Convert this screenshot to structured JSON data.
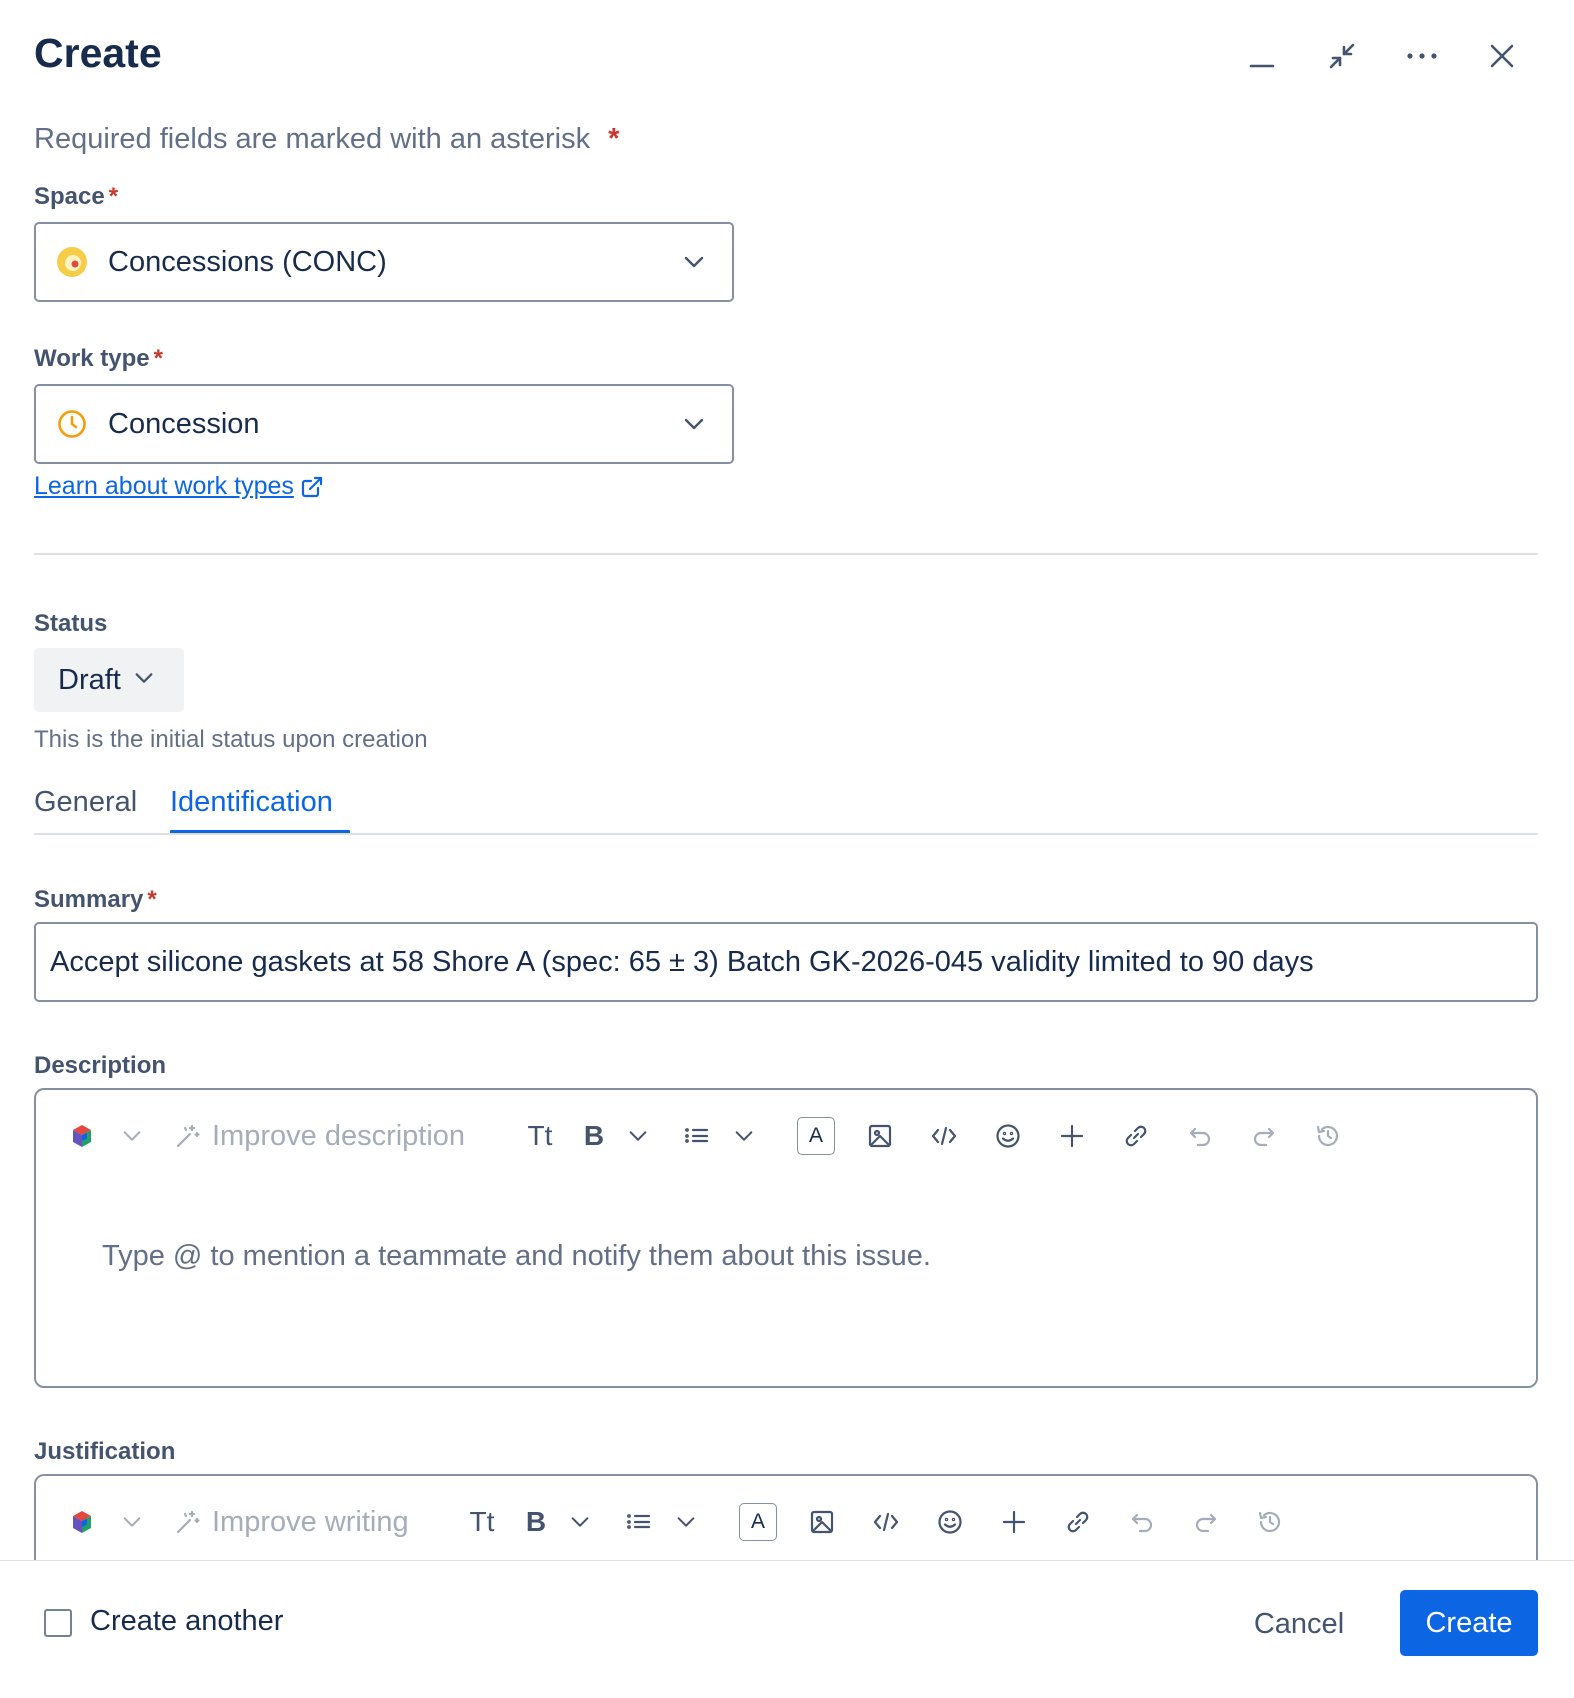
{
  "header": {
    "title": "Create",
    "actions": [
      "minimize-icon",
      "collapse-icon",
      "more-icon",
      "close-icon"
    ]
  },
  "required_note": "Required fields are marked with an asterisk",
  "required_marker": "*",
  "space": {
    "label": "Space",
    "value": "Concessions (CONC)",
    "icon": "project-avatar-icon"
  },
  "work_type": {
    "label": "Work type",
    "value": "Concession",
    "icon": "clock-icon",
    "learn_link": "Learn about work types"
  },
  "status": {
    "label": "Status",
    "value": "Draft",
    "help": "This is the initial status upon creation"
  },
  "tabs": [
    {
      "label": "General",
      "active": false
    },
    {
      "label": "Identification",
      "active": true
    }
  ],
  "summary": {
    "label": "Summary",
    "value": "Accept silicone gaskets at 58 Shore A (spec: 65 ± 3) Batch GK-2026-045 validity limited to 90 days"
  },
  "description": {
    "label": "Description",
    "improve_label": "Improve description",
    "placeholder": "Type @ to mention a teammate and notify them about this issue."
  },
  "justification": {
    "label": "Justification",
    "improve_label": "Improve writing"
  },
  "toolbar": {
    "text_style": "Tt",
    "bold": "B",
    "text_color": "A"
  },
  "footer": {
    "create_another": "Create another",
    "cancel": "Cancel",
    "create": "Create"
  },
  "colors": {
    "primary": "#0c66e4",
    "required": "#c9372c",
    "border": "#8590a2"
  }
}
